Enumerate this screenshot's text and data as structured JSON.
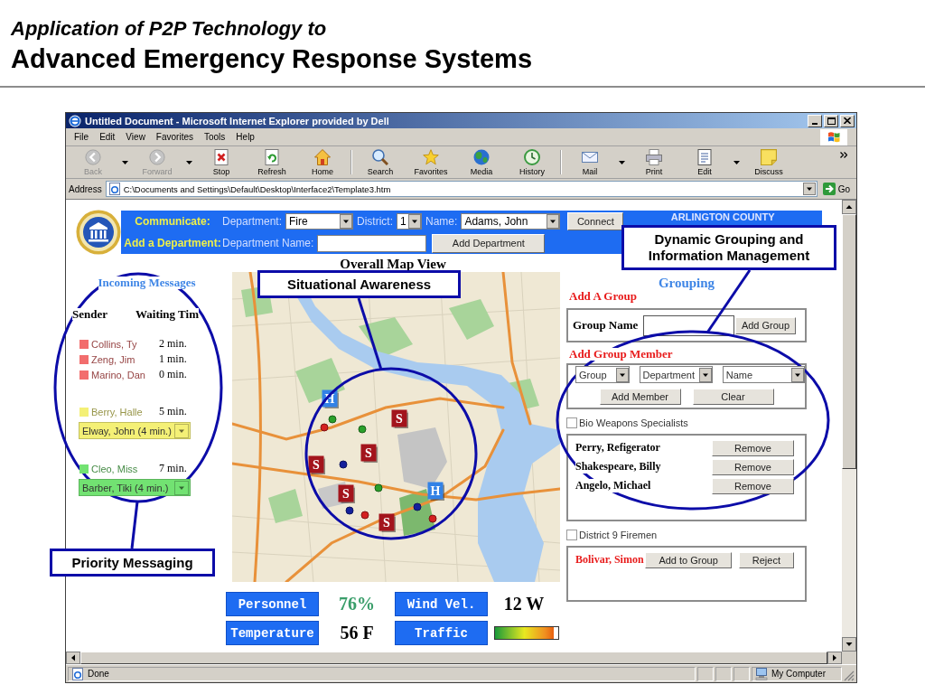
{
  "slide": {
    "title": "Application of P2P Technology to",
    "subtitle": "Advanced Emergency Response Systems"
  },
  "window": {
    "title": "Untitled Document - Microsoft Internet Explorer provided by Dell"
  },
  "menu": [
    "File",
    "Edit",
    "View",
    "Favorites",
    "Tools",
    "Help"
  ],
  "toolbar": {
    "groups": [
      {
        "buttons": [
          {
            "label": "Back",
            "disabled": true,
            "dropdown": true
          },
          {
            "label": "Forward",
            "disabled": true,
            "dropdown": true
          },
          {
            "label": "Stop",
            "disabled": false,
            "dropdown": false
          },
          {
            "label": "Refresh",
            "disabled": false,
            "dropdown": false
          },
          {
            "label": "Home",
            "disabled": false,
            "dropdown": false
          }
        ]
      },
      {
        "buttons": [
          {
            "label": "Search",
            "disabled": false,
            "dropdown": false
          },
          {
            "label": "Favorites",
            "disabled": false,
            "dropdown": false
          },
          {
            "label": "Media",
            "disabled": false,
            "dropdown": false
          },
          {
            "label": "History",
            "disabled": false,
            "dropdown": false
          }
        ]
      },
      {
        "buttons": [
          {
            "label": "Mail",
            "disabled": false,
            "dropdown": true
          },
          {
            "label": "Print",
            "disabled": false,
            "dropdown": false
          },
          {
            "label": "Edit",
            "disabled": false,
            "dropdown": true
          },
          {
            "label": "Discuss",
            "disabled": false,
            "dropdown": false
          }
        ]
      }
    ]
  },
  "address": {
    "label": "Address",
    "value": "C:\\Documents and Settings\\Default\\Desktop\\Interface2\\Template3.htm",
    "go": "Go"
  },
  "app": {
    "header": {
      "communicate": "Communicate:",
      "department_label": "Department:",
      "department": "Fire",
      "district_label": "District:",
      "district": "1",
      "name_label": "Name:",
      "name": "Adams, John",
      "connect": "Connect",
      "add_department": "Add a Department:",
      "department_name_label": "Department Name:",
      "add_department_button": "Add Department",
      "county": "ARLINGTON COUNTY"
    },
    "messages": {
      "title": "Incoming Messages",
      "columns": [
        "Sender",
        "Waiting Tim"
      ],
      "groups": [
        {
          "color": "#f26d6d",
          "items": [
            {
              "sender": "Collins, Ty",
              "wait": "2 min."
            },
            {
              "sender": "Zeng, Jim",
              "wait": "1 min."
            },
            {
              "sender": "Marino, Dan",
              "wait": "0 min."
            }
          ]
        },
        {
          "color": "#f4f076",
          "items": [
            {
              "sender": "Berry, Halle",
              "wait": "5 min."
            }
          ],
          "queue": "Elway, John (4 min.)"
        },
        {
          "color": "#72e272",
          "items": [
            {
              "sender": "Cleo, Miss",
              "wait": "7 min."
            }
          ],
          "queue": "Barber, Tiki (4 min.)"
        }
      ]
    },
    "map": {
      "title": "Overall Map View",
      "markers": [
        {
          "kind": "tile",
          "label": "H",
          "color": "#3282e6"
        },
        {
          "kind": "tile",
          "label": "S",
          "color": "#a3141c"
        },
        {
          "kind": "dot",
          "color": "#2aa02a"
        },
        {
          "kind": "dot",
          "color": "#d42020"
        },
        {
          "kind": "dot",
          "color": "#2aa02a"
        },
        {
          "kind": "tile",
          "label": "S",
          "color": "#a3141c"
        },
        {
          "kind": "tile",
          "label": "S",
          "color": "#a3141c"
        },
        {
          "kind": "dot",
          "color": "#14209c"
        },
        {
          "kind": "dot",
          "color": "#2aa02a"
        },
        {
          "kind": "tile",
          "label": "H",
          "color": "#3282e6"
        },
        {
          "kind": "tile",
          "label": "S",
          "color": "#a3141c"
        },
        {
          "kind": "dot",
          "color": "#14209c"
        },
        {
          "kind": "dot",
          "color": "#14209c"
        },
        {
          "kind": "dot",
          "color": "#d42020"
        },
        {
          "kind": "dot",
          "color": "#d42020"
        },
        {
          "kind": "tile",
          "label": "S",
          "color": "#a3141c"
        }
      ]
    },
    "stats": [
      {
        "label": "Personnel",
        "kind": "text",
        "value": "76%",
        "color": "#3a9e6a"
      },
      {
        "label": "Wind Vel.",
        "kind": "text",
        "value": "12 W",
        "color": "#000000"
      },
      {
        "label": "Temperature",
        "kind": "text",
        "value": "56 F",
        "color": "#000000"
      },
      {
        "label": "Traffic",
        "kind": "meter",
        "level": 0.93
      }
    ],
    "grouping": {
      "title": "Grouping",
      "add_group": {
        "heading": "Add A Group",
        "label": "Group Name",
        "button": "Add Group"
      },
      "add_member": {
        "heading": "Add Group Member",
        "selects": [
          "Group",
          "Department",
          "Name"
        ],
        "buttons": [
          "Add Member",
          "Clear"
        ]
      },
      "groups": [
        {
          "name": "Bio Weapons Specialists",
          "checked": false,
          "members": [
            {
              "name": "Perry, Refigerator",
              "pending": false,
              "actions": [
                "Remove"
              ]
            },
            {
              "name": "Shakespeare, Billy",
              "pending": false,
              "actions": [
                "Remove"
              ]
            },
            {
              "name": "Angelo, Michael",
              "pending": false,
              "actions": [
                "Remove"
              ]
            }
          ]
        },
        {
          "name": "District 9 Firemen",
          "checked": false,
          "members": [
            {
              "name": "Bolivar, Simon",
              "pending": true,
              "actions": [
                "Add to Group",
                "Reject"
              ]
            }
          ]
        }
      ]
    }
  },
  "status_bar": {
    "text": "Done",
    "zone": "My Computer"
  },
  "callouts": [
    {
      "text": "Dynamic Grouping and Information Management"
    },
    {
      "text": "Situational Awareness"
    },
    {
      "text": "Priority Messaging"
    }
  ]
}
